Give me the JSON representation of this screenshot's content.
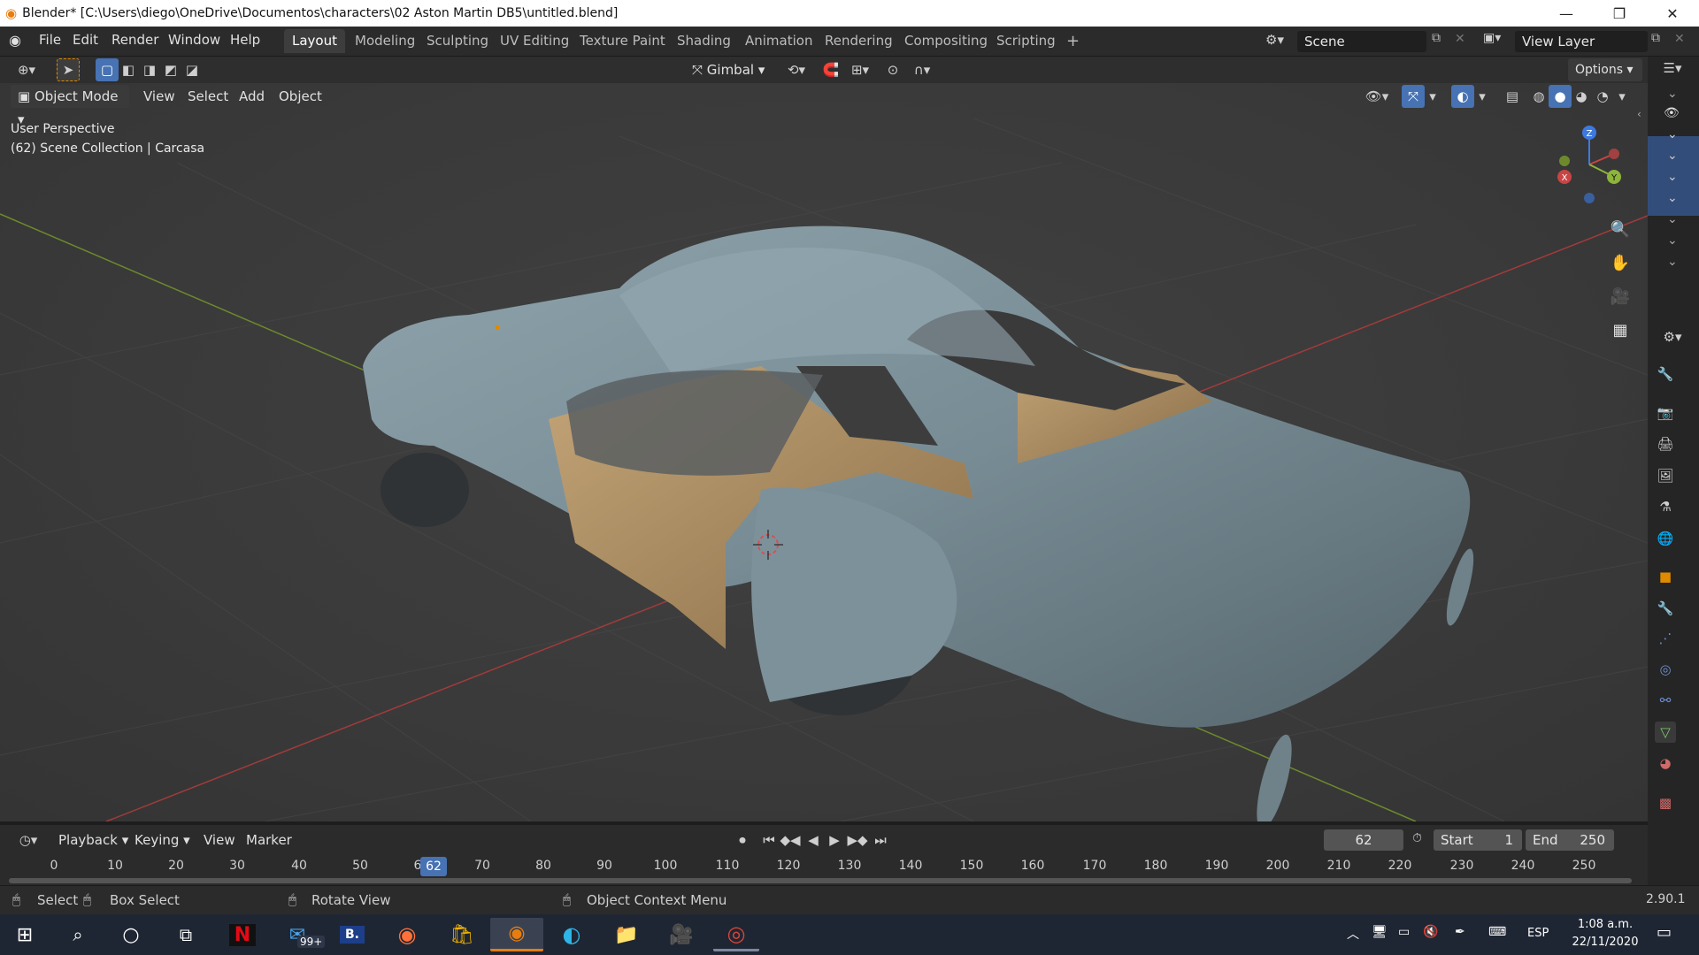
{
  "window": {
    "title": "Blender* [C:\\Users\\diego\\OneDrive\\Documentos\\characters\\02 Aston Martin DB5\\untitled.blend]",
    "minimize": "—",
    "maximize": "❐",
    "close": "✕"
  },
  "menubar": {
    "items": [
      "File",
      "Edit",
      "Render",
      "Window",
      "Help"
    ]
  },
  "workspaces": {
    "tabs": [
      "Layout",
      "Modeling",
      "Sculpting",
      "UV Editing",
      "Texture Paint",
      "Shading",
      "Animation",
      "Rendering",
      "Compositing",
      "Scripting"
    ],
    "active": "Layout",
    "add": "+"
  },
  "scene": {
    "name": "Scene",
    "view_layer": "View Layer"
  },
  "tool_header": {
    "orientation": "Gimbal",
    "options": "Options"
  },
  "viewport_header": {
    "mode": "Object Mode",
    "menus": [
      "View",
      "Select",
      "Add",
      "Object"
    ]
  },
  "viewport": {
    "perspective_label": "User Perspective",
    "collection_label": "(62) Scene Collection | Carcasa",
    "gizmo": {
      "x": "X",
      "y": "Y",
      "z": "Z"
    }
  },
  "timeline": {
    "menus": [
      "Playback",
      "Keying",
      "View",
      "Marker"
    ],
    "current_frame": "62",
    "start_label": "Start",
    "start_value": "1",
    "end_label": "End",
    "end_value": "250",
    "ruler_ticks": [
      "0",
      "10",
      "20",
      "30",
      "40",
      "50",
      "6",
      "70",
      "80",
      "90",
      "100",
      "110",
      "120",
      "130",
      "140",
      "150",
      "160",
      "170",
      "180",
      "190",
      "200",
      "210",
      "220",
      "230",
      "240",
      "250"
    ],
    "playhead": "62"
  },
  "statusbar": {
    "select": "Select",
    "box_select": "Box Select",
    "rotate_view": "Rotate View",
    "context_menu": "Object Context Menu",
    "version": "2.90.1"
  },
  "taskbar": {
    "mail_badge": "99+",
    "language": "ESP",
    "time": "1:08 a.m.",
    "date": "22/11/2020"
  },
  "colors": {
    "accent": "#4772b3",
    "active_outline": "#e08a00",
    "car_body": "#7a8e97",
    "car_interior": "#a98c63",
    "x_axis": "#c94444",
    "y_axis": "#8db43b",
    "z_axis": "#3d7ae0"
  }
}
